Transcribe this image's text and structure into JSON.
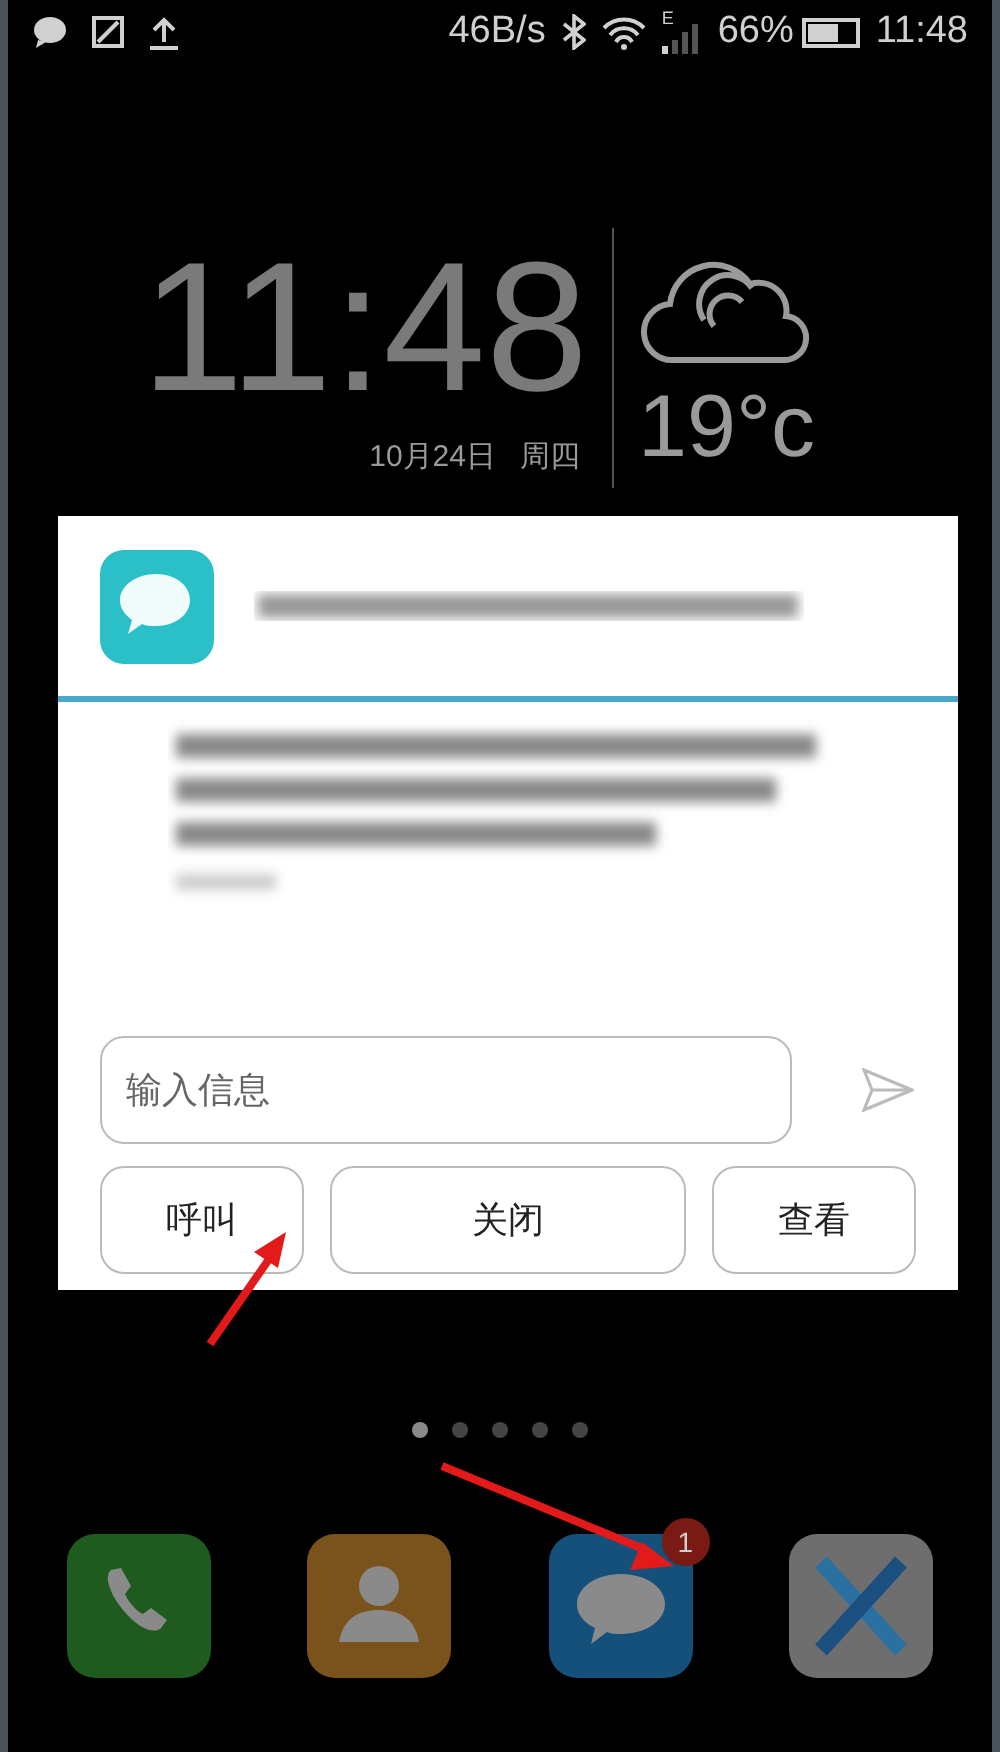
{
  "status_bar": {
    "network_speed": "46B/s",
    "network_type": "E",
    "battery": {
      "reading": "66%"
    },
    "time": "11:48"
  },
  "clock_widget": {
    "time": "11:48",
    "date": "10月24日",
    "weekday": "周四",
    "temperature": "19°c"
  },
  "message_dialog": {
    "input": {
      "placeholder": "输入信息"
    },
    "buttons": [
      {
        "label": "呼叫",
        "kind": "narrow"
      },
      {
        "label": "关闭",
        "kind": "wide"
      },
      {
        "label": "查看",
        "kind": "narrow"
      }
    ]
  },
  "page_indicator": [
    {
      "selected": true
    },
    {
      "selected": false
    },
    {
      "selected": false
    },
    {
      "selected": false
    },
    {
      "selected": false
    }
  ],
  "dock": [
    {
      "kind": "phone",
      "color": "#1f5a1f"
    },
    {
      "kind": "contacts",
      "color": "#7a531c"
    },
    {
      "kind": "messages",
      "color": "#14507a",
      "badge": "1"
    },
    {
      "kind": "browser",
      "color": "#6e6e6e"
    }
  ]
}
